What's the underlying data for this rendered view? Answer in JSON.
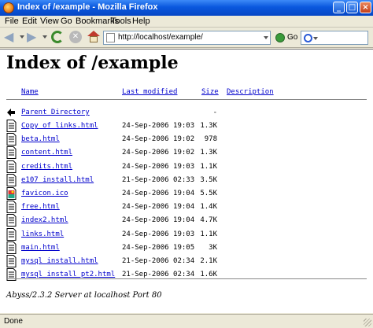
{
  "window": {
    "title": "Index of /example - Mozilla Firefox"
  },
  "menu": [
    "File",
    "Edit",
    "View",
    "Go",
    "Bookmarks",
    "Tools",
    "Help"
  ],
  "toolbar": {
    "url": "http://localhost/example/",
    "go_label": "Go"
  },
  "page": {
    "heading": "Index of /example",
    "columns": {
      "name": "Name",
      "modified": "Last modified",
      "size": "Size",
      "description": "Description"
    },
    "parent": {
      "name": "Parent Directory",
      "size": "-"
    },
    "files": [
      {
        "name": "Copy of links.html",
        "modified": "24-Sep-2006 19:03",
        "size": "1.3K",
        "icon": "text-file-icon"
      },
      {
        "name": "beta.html",
        "modified": "24-Sep-2006 19:02",
        "size": "978",
        "icon": "text-file-icon"
      },
      {
        "name": "content.html",
        "modified": "24-Sep-2006 19:02",
        "size": "1.3K",
        "icon": "text-file-icon"
      },
      {
        "name": "credits.html",
        "modified": "24-Sep-2006 19:03",
        "size": "1.1K",
        "icon": "text-file-icon"
      },
      {
        "name": "e107 install.html",
        "modified": "21-Sep-2006 02:33",
        "size": "3.5K",
        "icon": "text-file-icon"
      },
      {
        "name": "favicon.ico",
        "modified": "24-Sep-2006 19:04",
        "size": "5.5K",
        "icon": "image-file-icon"
      },
      {
        "name": "free.html",
        "modified": "24-Sep-2006 19:04",
        "size": "1.4K",
        "icon": "text-file-icon"
      },
      {
        "name": "index2.html",
        "modified": "24-Sep-2006 19:04",
        "size": "4.7K",
        "icon": "text-file-icon"
      },
      {
        "name": "links.html",
        "modified": "24-Sep-2006 19:03",
        "size": "1.1K",
        "icon": "text-file-icon"
      },
      {
        "name": "main.html",
        "modified": "24-Sep-2006 19:05",
        "size": "3K",
        "icon": "text-file-icon"
      },
      {
        "name": "mysql install.html",
        "modified": "21-Sep-2006 02:34",
        "size": "2.1K",
        "icon": "text-file-icon"
      },
      {
        "name": "mysql install pt2.html",
        "modified": "21-Sep-2006 02:34",
        "size": "1.6K",
        "icon": "text-file-icon"
      }
    ],
    "footer": "Abyss/2.3.2 Server at localhost Port 80"
  },
  "status": {
    "text": "Done"
  }
}
